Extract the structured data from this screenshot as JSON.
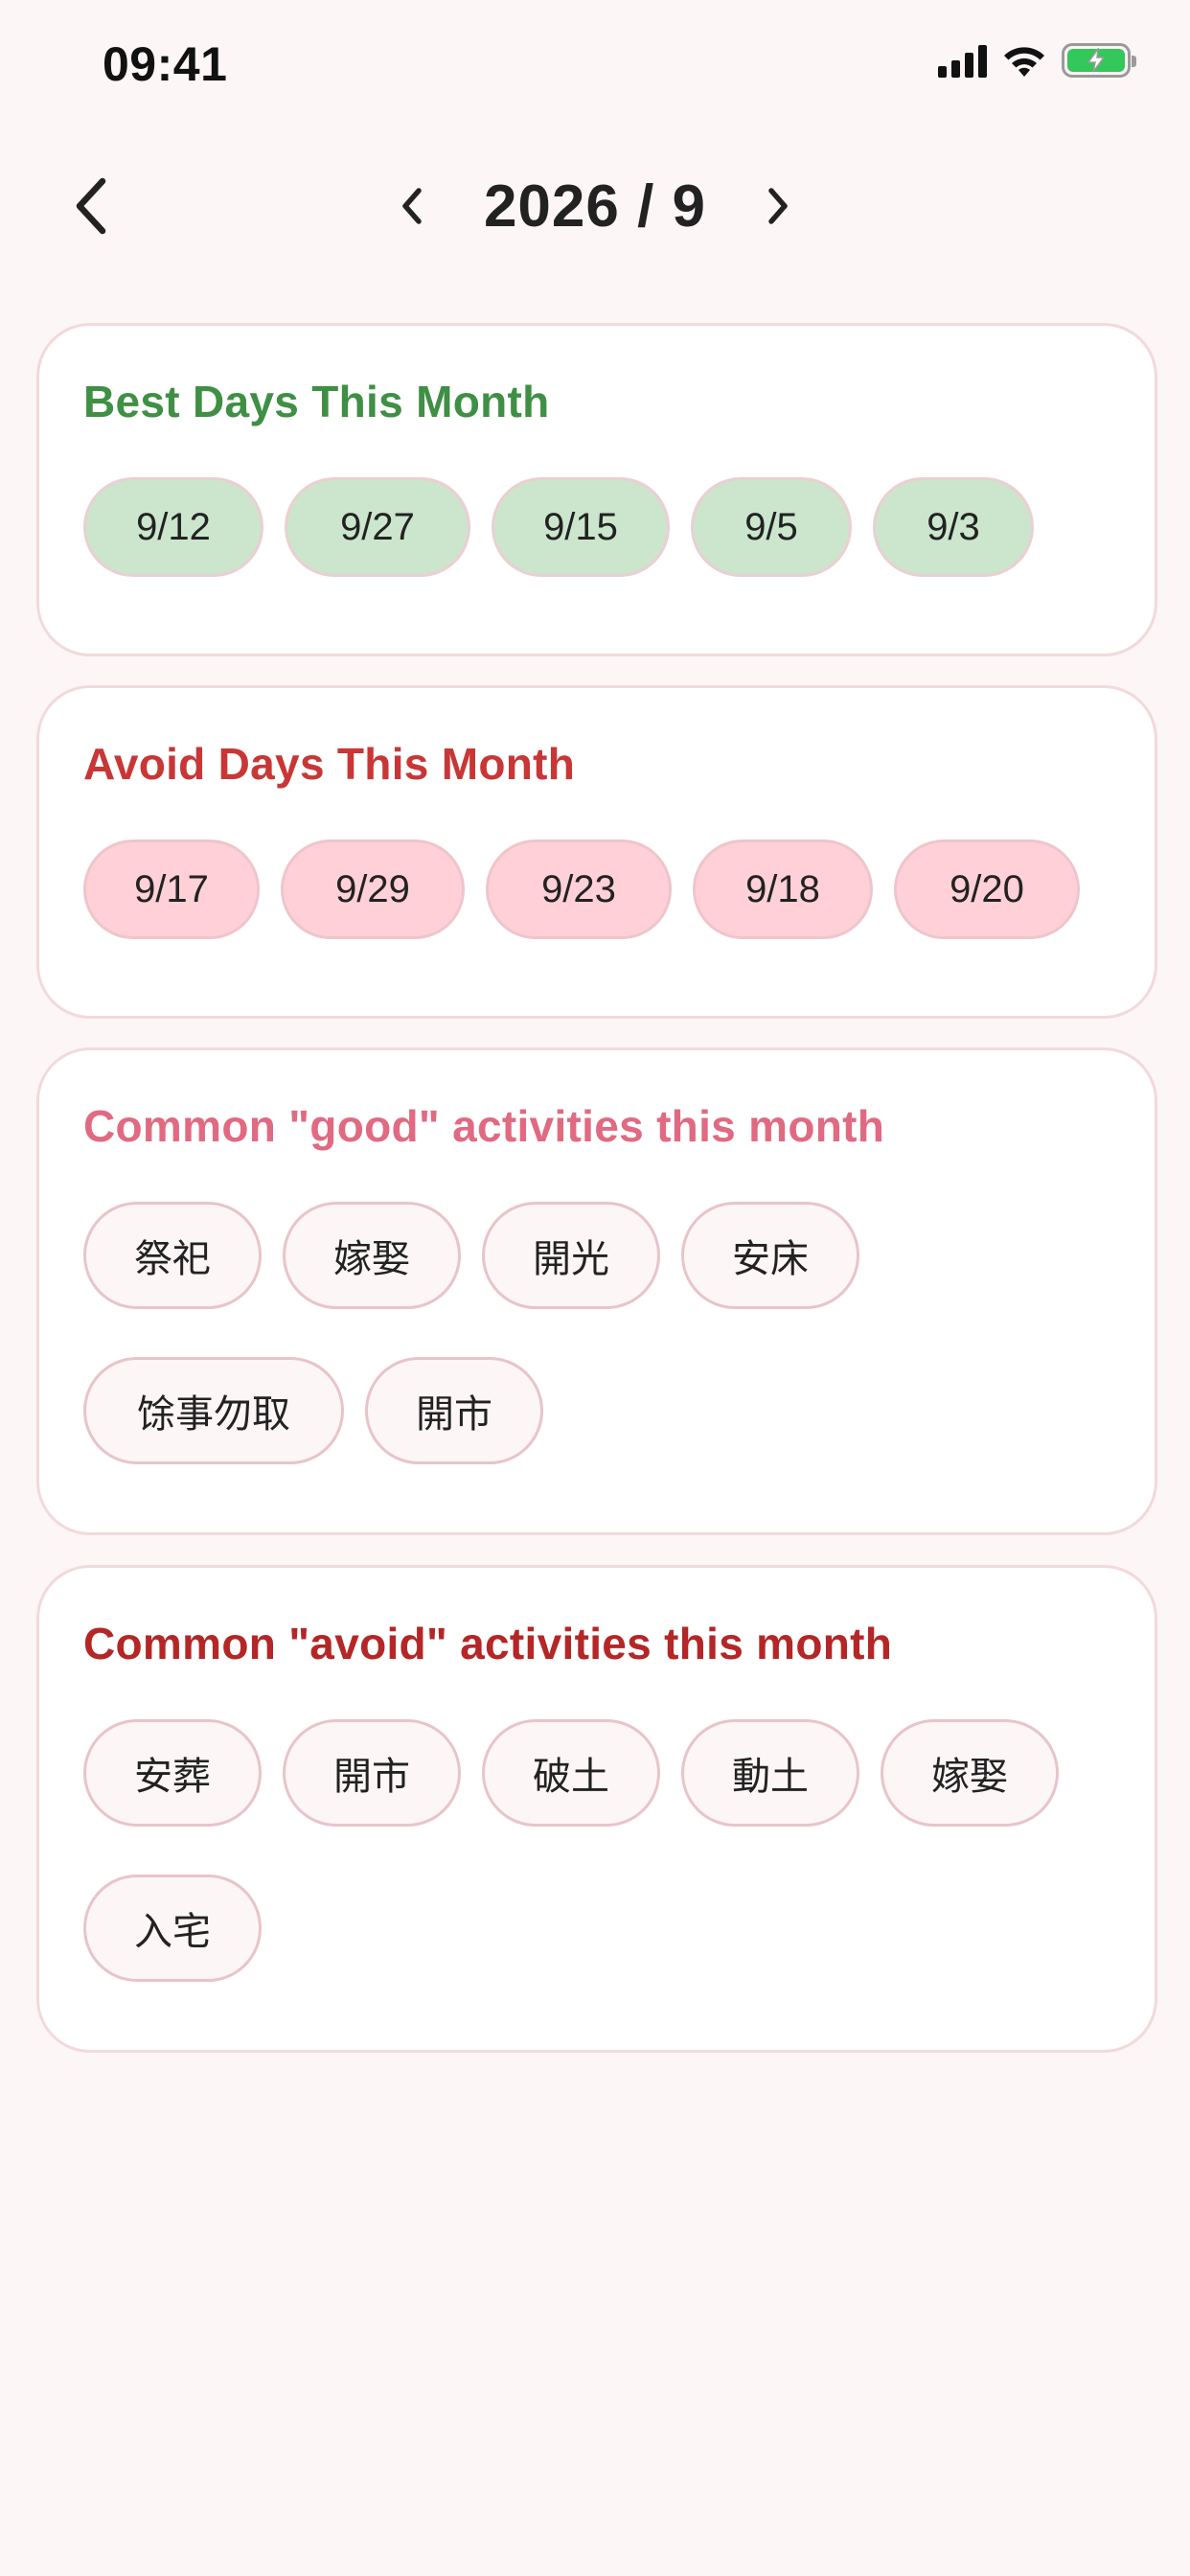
{
  "status_bar": {
    "time": "09:41"
  },
  "nav": {
    "month_title": "2026 / 9"
  },
  "best_days": {
    "title": "Best Days This Month",
    "color": "#3f8f44",
    "days": [
      "9/12",
      "9/27",
      "9/15",
      "9/5",
      "9/3"
    ]
  },
  "avoid_days": {
    "title": "Avoid Days This Month",
    "color": "#c93636",
    "days": [
      "9/17",
      "9/29",
      "9/23",
      "9/18",
      "9/20"
    ]
  },
  "good_activities": {
    "title": "Common \"good\" activities this month",
    "color": "#e06a82",
    "items": [
      "祭祀",
      "嫁娶",
      "開光",
      "安床",
      "馀事勿取",
      "開市"
    ]
  },
  "avoid_activities": {
    "title": "Common \"avoid\" activities this month",
    "color": "#b52626",
    "items": [
      "安葬",
      "開市",
      "破土",
      "動土",
      "嫁娶",
      "入宅"
    ]
  }
}
